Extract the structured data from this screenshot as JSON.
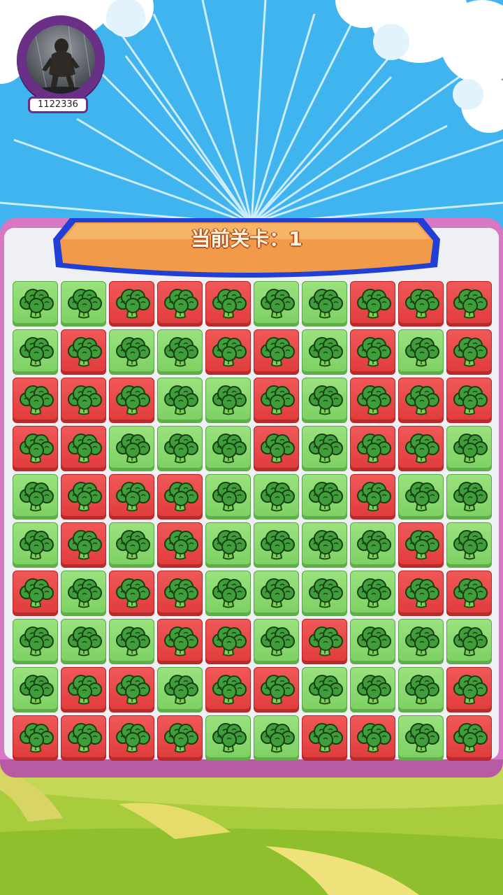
{
  "player": {
    "id_label": "1122336",
    "avatar_icon": "bigfoot-avatar-icon"
  },
  "level": {
    "label": "当前关卡：1"
  },
  "board": {
    "rows": 10,
    "cols": 10,
    "tile_icon": "broccoli-icon",
    "colors": {
      "G": "#86d86c",
      "R": "#e84848"
    },
    "grid": [
      [
        "G",
        "G",
        "R",
        "R",
        "R",
        "G",
        "G",
        "R",
        "R",
        "R"
      ],
      [
        "G",
        "R",
        "G",
        "G",
        "R",
        "R",
        "G",
        "R",
        "G",
        "R"
      ],
      [
        "R",
        "R",
        "R",
        "G",
        "G",
        "R",
        "G",
        "R",
        "R",
        "R"
      ],
      [
        "R",
        "R",
        "G",
        "G",
        "G",
        "R",
        "G",
        "R",
        "R",
        "G"
      ],
      [
        "G",
        "R",
        "R",
        "R",
        "G",
        "G",
        "G",
        "R",
        "G",
        "G"
      ],
      [
        "G",
        "R",
        "G",
        "R",
        "G",
        "G",
        "G",
        "G",
        "R",
        "G"
      ],
      [
        "R",
        "G",
        "R",
        "R",
        "G",
        "G",
        "G",
        "G",
        "R",
        "R"
      ],
      [
        "G",
        "G",
        "G",
        "R",
        "R",
        "G",
        "R",
        "G",
        "G",
        "G"
      ],
      [
        "G",
        "R",
        "R",
        "G",
        "R",
        "R",
        "G",
        "G",
        "G",
        "R"
      ],
      [
        "R",
        "R",
        "R",
        "R",
        "G",
        "G",
        "R",
        "R",
        "G",
        "R"
      ]
    ]
  }
}
